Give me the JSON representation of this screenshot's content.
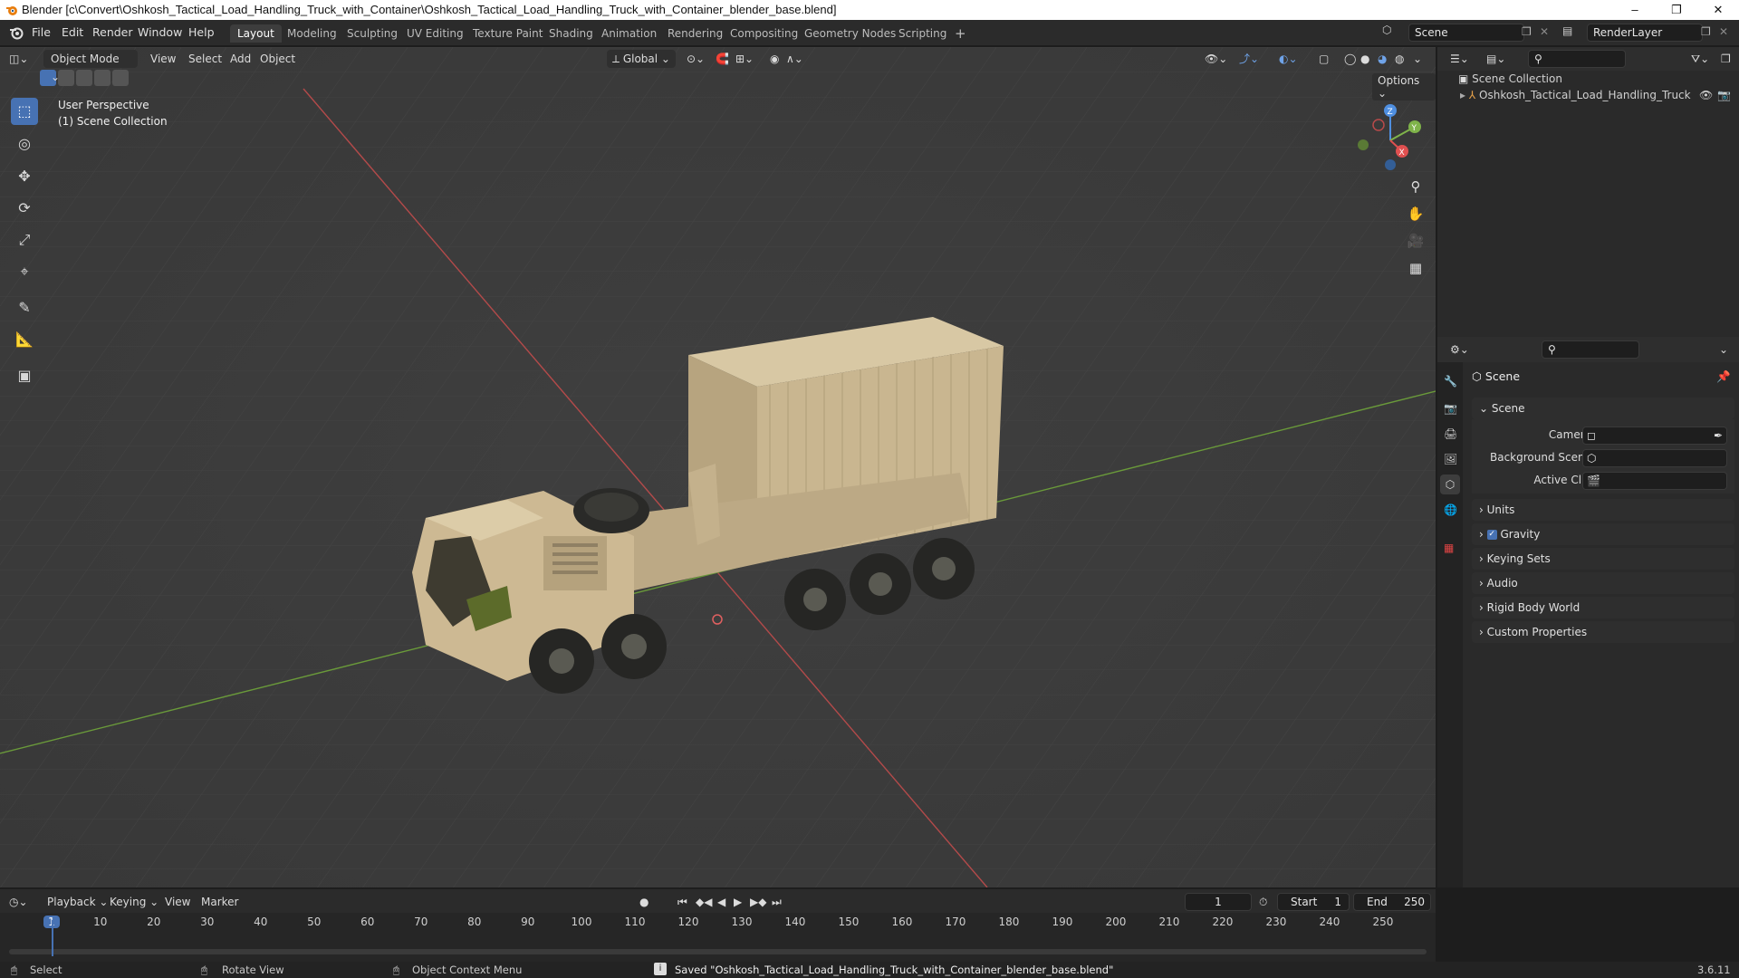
{
  "window": {
    "title": "Blender [c\\Convert\\Oshkosh_Tactical_Load_Handling_Truck_with_Container\\Oshkosh_Tactical_Load_Handling_Truck_with_Container_blender_base.blend]",
    "minimize": "–",
    "maximize": "❐",
    "close": "✕"
  },
  "menu": [
    "File",
    "Edit",
    "Render",
    "Window",
    "Help"
  ],
  "workspaces": [
    "Layout",
    "Modeling",
    "Sculpting",
    "UV Editing",
    "Texture Paint",
    "Shading",
    "Animation",
    "Rendering",
    "Compositing",
    "Geometry Nodes",
    "Scripting"
  ],
  "workspace_add": "+",
  "scene_name": "Scene",
  "view_layer": "RenderLayer",
  "viewport": {
    "mode": "Object Mode",
    "menus": [
      "View",
      "Select",
      "Add",
      "Object"
    ],
    "transform_orientation": "Global",
    "options_label": "Options",
    "info_line1": "User Perspective",
    "info_line2": "(1) Scene Collection",
    "gizmo_axes": {
      "z": "Z",
      "y": "Y",
      "x": "X"
    }
  },
  "outliner": {
    "root": "Scene Collection",
    "items": [
      "Oshkosh_Tactical_Load_Handling_Truck"
    ]
  },
  "properties": {
    "context_title": "Scene",
    "panel_title": "Scene",
    "fields": [
      {
        "label": "Camera",
        "value": ""
      },
      {
        "label": "Background Scene",
        "value": ""
      },
      {
        "label": "Active Clip",
        "value": ""
      }
    ],
    "sections": [
      "Units",
      "Gravity",
      "Keying Sets",
      "Audio",
      "Rigid Body World",
      "Custom Properties"
    ]
  },
  "timeline": {
    "menus": [
      "Playback",
      "Keying",
      "View",
      "Marker"
    ],
    "current_frame": "1",
    "start_label": "Start",
    "start": "1",
    "end_label": "End",
    "end": "250",
    "ticks": [
      "1",
      "10",
      "20",
      "30",
      "40",
      "50",
      "60",
      "70",
      "80",
      "90",
      "100",
      "110",
      "120",
      "130",
      "140",
      "150",
      "160",
      "170",
      "180",
      "190",
      "200",
      "210",
      "220",
      "230",
      "240",
      "250"
    ]
  },
  "status": {
    "select": "Select",
    "rotate": "Rotate View",
    "context_menu": "Object Context Menu",
    "message": "Saved \"Oshkosh_Tactical_Load_Handling_Truck_with_Container_blender_base.blend\"",
    "version": "3.6.11"
  },
  "colors": {
    "accent": "#4772b3",
    "x_axis": "#d94a4a",
    "y_axis": "#7fb34a",
    "truck": "#c8b48e"
  }
}
